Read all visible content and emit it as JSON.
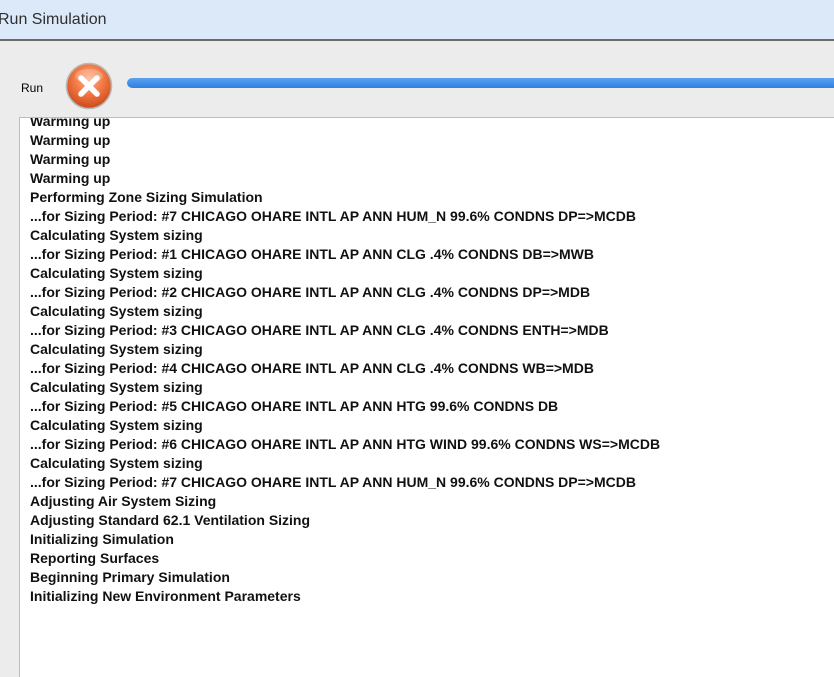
{
  "window": {
    "title": "Run Simulation"
  },
  "toolbar": {
    "run_label": "Run",
    "stop_icon": "stop-x-circle-icon",
    "progress_fraction": 1.0,
    "colors": {
      "stop_icon": "#f0743e",
      "progress": "#3a8ae8",
      "titlebar": "#dce9f9"
    }
  },
  "log": {
    "lines": [
      "Warming up",
      "Warming up",
      "Warming up",
      "Warming up",
      "Performing Zone Sizing Simulation",
      "...for Sizing Period: #7 CHICAGO OHARE INTL AP ANN HUM_N 99.6% CONDNS DP=>MCDB",
      "Calculating System sizing",
      "...for Sizing Period: #1 CHICAGO OHARE INTL AP ANN CLG .4% CONDNS DB=>MWB",
      "Calculating System sizing",
      "...for Sizing Period: #2 CHICAGO OHARE INTL AP ANN CLG .4% CONDNS DP=>MDB",
      "Calculating System sizing",
      "...for Sizing Period: #3 CHICAGO OHARE INTL AP ANN CLG .4% CONDNS ENTH=>MDB",
      "Calculating System sizing",
      "...for Sizing Period: #4 CHICAGO OHARE INTL AP ANN CLG .4% CONDNS WB=>MDB",
      "Calculating System sizing",
      "...for Sizing Period: #5 CHICAGO OHARE INTL AP ANN HTG 99.6% CONDNS DB",
      "Calculating System sizing",
      "...for Sizing Period: #6 CHICAGO OHARE INTL AP ANN HTG WIND 99.6% CONDNS WS=>MCDB",
      "Calculating System sizing",
      "...for Sizing Period: #7 CHICAGO OHARE INTL AP ANN HUM_N 99.6% CONDNS DP=>MCDB",
      "Adjusting Air System Sizing",
      "Adjusting Standard 62.1 Ventilation Sizing",
      "Initializing Simulation",
      "Reporting Surfaces",
      "Beginning Primary Simulation",
      "Initializing New Environment Parameters"
    ]
  }
}
